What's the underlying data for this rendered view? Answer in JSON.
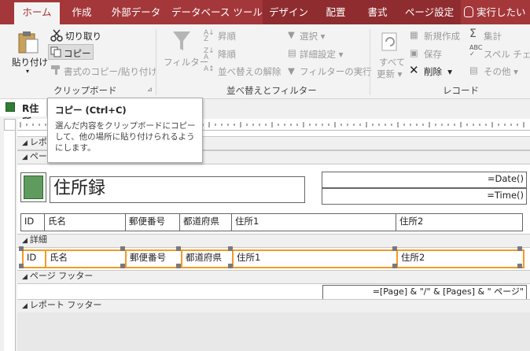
{
  "tabs": {
    "home": "ホーム",
    "create": "作成",
    "external": "外部データ",
    "dbtools": "データベース ツール",
    "design": "デザイン",
    "arrange": "配置",
    "format": "書式",
    "pagesetup": "ページ設定",
    "tellme": "実行したい"
  },
  "clipboard": {
    "paste": "貼り付け",
    "cut": "切り取り",
    "copy": "コピー",
    "format_painter": "書式のコピー/貼り付け",
    "group": "クリップボード"
  },
  "sortfilter": {
    "filter": "フィルター",
    "ascending": "昇順",
    "descending": "降順",
    "remove_sort": "並べ替えの解除",
    "selection": "選択",
    "advanced": "詳細設定",
    "toggle_filter": "フィルターの実行",
    "group": "並べ替えとフィルター"
  },
  "records": {
    "refresh_all": "すべて",
    "refresh_all2": "更新",
    "new": "新規作成",
    "save": "保存",
    "delete": "削除",
    "totals": "集計",
    "spelling": "スペル チェッ",
    "more": "その他",
    "group": "レコード"
  },
  "tooltip": {
    "title": "コピー (Ctrl+C)",
    "body": "選んだ内容をクリップボードにコピーして、他の場所に貼り付けられるようにします。"
  },
  "doc": {
    "tab_title": "R住所"
  },
  "sections": {
    "report_header": "レポート",
    "page_header": "ペー",
    "detail": "詳細",
    "page_footer": "ページ フッター",
    "report_footer": "レポート フッター"
  },
  "report": {
    "title": "住所録",
    "date": "=Date()",
    "time": "=Time()",
    "labels": [
      "ID",
      "氏名",
      "郵便番号",
      "都道府県",
      "住所1",
      "住所2"
    ],
    "fields": [
      "ID",
      "氏名",
      "郵便番号",
      "都道府県",
      "住所1",
      "住所2"
    ],
    "page_expr": "=[Page] & \"/\" & [Pages] & \" ページ\""
  }
}
